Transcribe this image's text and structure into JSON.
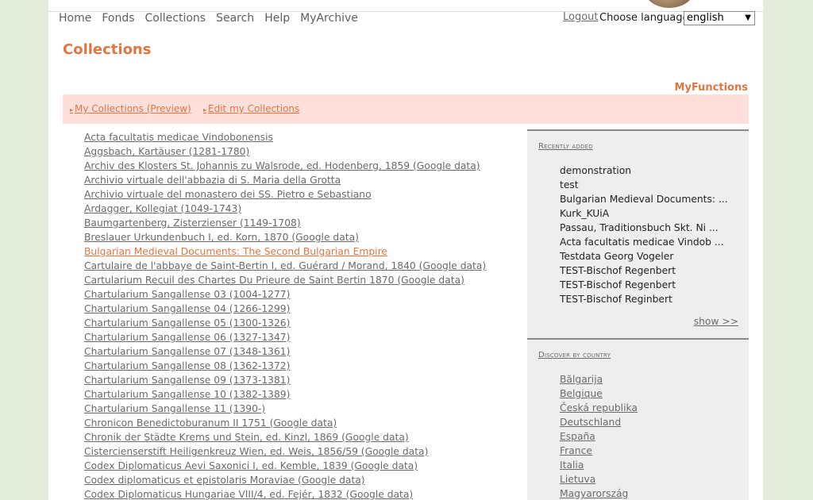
{
  "nav": {
    "items": [
      "Home",
      "Fonds",
      "Collections",
      "Search",
      "Help",
      "MyArchive"
    ],
    "logout": "Logout",
    "language_label": "Choose language:",
    "language_value": "english"
  },
  "page": {
    "title": "Collections",
    "myfunctions": "MyFunctions",
    "func_links": [
      "My Collections (Preview)",
      "Edit my Collections"
    ]
  },
  "collections": [
    "Acta facultatis medicae Vindobonensis",
    "Aggsbach, Kartäuser (1281-1780)",
    "Archiv des Klosters St. Johannis zu Walsrode, ed. Hodenberg, 1859 (Google data)",
    "Archivio virtuale dell'abbazia di S. Maria della Grotta",
    "Archivio virtuale del monastero dei SS. Pietro e Sebastiano",
    "Ardagger, Kollegiat (1049-1743)",
    "Baumgartenberg, Zisterzienser (1149-1708)",
    "Breslauer Urkundenbuch I, ed. Korn, 1870 (Google data)",
    "Bulgarian Medieval Documents: The Second Bulgarian Empire",
    "Cartulaire de l'abbaye de Saint-Bertin I, ed. Guérard / Morand, 1840 (Google data)",
    "Cartularium Recuil des Chartes Du Prieure de Saint Bertin 1870 (Google data)",
    "Chartularium Sangallense 03 (1004-1277)",
    "Chartularium Sangallense 04 (1266-1299)",
    "Chartularium Sangallense 05 (1300-1326)",
    "Chartularium Sangallense 06 (1327-1347)",
    "Chartularium Sangallense 07 (1348-1361)",
    "Chartularium Sangallense 08 (1362-1372)",
    "Chartularium Sangallense 09 (1373-1381)",
    "Chartularium Sangallense 10 (1382-1389)",
    "Chartularium Sangallense 11 (1390-)",
    "Chronicon Benedictoburanum II 1751 (Google data)",
    "Chronik der Städte Krems und Stein, ed. Kinzl, 1869 (Google data)",
    "Cistercienserstift Heiligenkreuz Wien, ed. Weis, 1856/59 (Google data)",
    "Codex Diplomaticus Aevi Saxonici I, ed. Kemble, 1839 (Google data)",
    "Codex diplomaticus et epistolaris Moraviae (Google data)",
    "Codex Diplomaticus Hungariae VIII/4, ed. Fejér, 1832 (Google data)"
  ],
  "sidebar": {
    "recent_heading": "Recently added",
    "recent_items": [
      "demonstration",
      "test",
      "Bulgarian Medieval Documents: ...",
      "Kurk_KUiA",
      "Passau, Traditionsbuch Skt. Ni ...",
      "Acta facultatis medicae Vindob ...",
      "Testdata Georg Vogeler",
      "TEST-Bischof Regenbert",
      "TEST-Bischof Regenbert",
      "TEST-Bischof Reginbert"
    ],
    "show_more": "show >>",
    "country_heading": "Discover by country",
    "countries": [
      "Bălgarija",
      "Belgique",
      "Česká republika",
      "Deutschland",
      "España",
      "France",
      "Italia",
      "Lietuva",
      "Magyarország"
    ]
  },
  "colors": {
    "accent": "#e07642",
    "highlight_bar": "#fde0dc",
    "sidebar_bg": "#eeeeee",
    "page_bg": "#e4ecdc"
  }
}
